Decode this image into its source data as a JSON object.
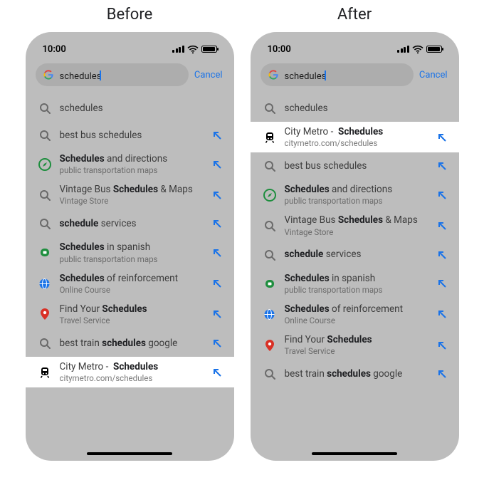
{
  "labels": {
    "before": "Before",
    "after": "After"
  },
  "status": {
    "time": "10:00"
  },
  "search": {
    "query": "schedules",
    "cancel": "Cancel"
  },
  "colors": {
    "link": "#1a73e8",
    "muted": "#6a6a6a",
    "text": "#202124"
  },
  "suggestions": {
    "schedules": {
      "text": "schedules"
    },
    "bestBus": {
      "text_html": "best bus schedules"
    },
    "dir": {
      "title_html": "<b>Schedules</b> and directions",
      "sub": "public transportation maps"
    },
    "vintage": {
      "title_html": "Vintage Bus <b>Schedules</b> &amp; Maps",
      "sub": "Vintage Store"
    },
    "services": {
      "text_html": "<b>schedule</b> services"
    },
    "spanish": {
      "title_html": "<b>Schedules</b> in spanish",
      "sub": "public transportation maps"
    },
    "reinf": {
      "title_html": "<b>Schedules</b> of reinforcement",
      "sub": "Online Course"
    },
    "findyour": {
      "title_html": "Find Your <b>Schedules</b>",
      "sub": "Travel Service"
    },
    "train": {
      "text_html": "best train <b>schedules</b> google"
    },
    "citymetro": {
      "title_html": "City Metro -&nbsp;&nbsp;<b>Schedules</b>",
      "sub": "citymetro.com/schedules"
    }
  }
}
